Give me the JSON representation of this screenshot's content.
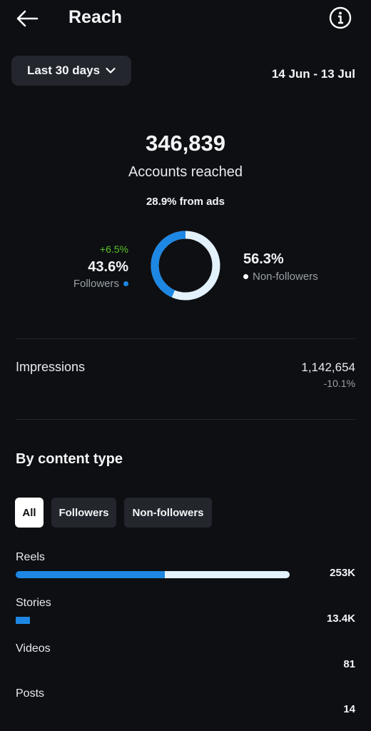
{
  "header": {
    "title": "Reach",
    "back_icon": "arrow-left-icon",
    "info_icon": "info-circle-icon"
  },
  "range": {
    "label": "Last 30 days",
    "dates": "14 Jun - 13 Jul"
  },
  "summary": {
    "accounts_reached": "346,839",
    "accounts_reached_label": "Accounts reached",
    "ads_line": "28.9% from ads"
  },
  "audience": {
    "followers_change": "+6.5%",
    "followers_pct": "43.6%",
    "followers_label": "Followers",
    "nonfollowers_pct": "56.3%",
    "nonfollowers_label": "Non-followers",
    "followers_fraction": 0.436
  },
  "impressions": {
    "label": "Impressions",
    "value": "1,142,654",
    "change": "-10.1%"
  },
  "content_type": {
    "title": "By content type",
    "filters": [
      "All",
      "Followers",
      "Non-followers"
    ],
    "active_filter": "All",
    "rows": [
      {
        "label": "Reels",
        "value": "253K",
        "followers_fraction": 0.545,
        "nonfollowers_fraction": 0.455,
        "total_fraction": 1.0
      },
      {
        "label": "Stories",
        "value": "13.4K",
        "followers_fraction": 1.0,
        "nonfollowers_fraction": 0.0,
        "total_fraction": 0.053
      },
      {
        "label": "Videos",
        "value": "81"
      },
      {
        "label": "Posts",
        "value": "14"
      }
    ]
  },
  "colors": {
    "background": "#0d0f13",
    "followers": "#1d87e3",
    "nonfollowers": "#e3f1fc",
    "positive": "#58c322",
    "chip": "#23262d"
  }
}
